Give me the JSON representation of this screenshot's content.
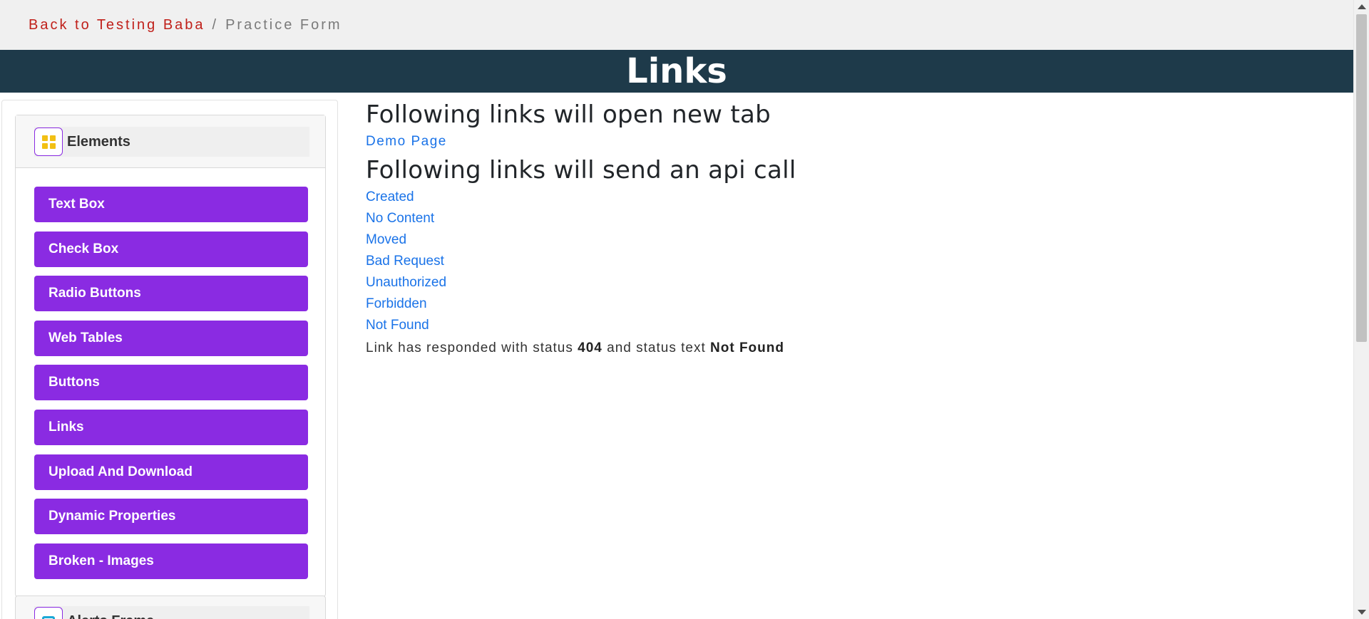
{
  "breadcrumb": {
    "link_label": "Back to Testing Baba",
    "separator": "/",
    "current": "Practice Form"
  },
  "page_title": "Links",
  "sidebar": {
    "group_title": "Elements",
    "items": [
      {
        "label": "Text Box"
      },
      {
        "label": "Check Box"
      },
      {
        "label": "Radio Buttons"
      },
      {
        "label": "Web Tables"
      },
      {
        "label": "Buttons"
      },
      {
        "label": "Links"
      },
      {
        "label": "Upload And Download"
      },
      {
        "label": "Dynamic Properties"
      },
      {
        "label": "Broken - Images"
      }
    ],
    "next_group_title": "Alerts Frame"
  },
  "main": {
    "heading_new_tab": "Following links will open new tab",
    "demo_link": "Demo Page",
    "heading_api": "Following links will send an api call",
    "api_links": [
      {
        "label": "Created"
      },
      {
        "label": "No Content"
      },
      {
        "label": "Moved"
      },
      {
        "label": "Bad Request"
      },
      {
        "label": "Unauthorized"
      },
      {
        "label": "Forbidden"
      },
      {
        "label": "Not Found"
      }
    ],
    "response": {
      "prefix": "Link has responded with status",
      "status_code": "404",
      "middle": "and status text",
      "status_text": "Not Found"
    }
  },
  "colors": {
    "accent_purple": "#8a2be2",
    "header_dark": "#1e3a4a",
    "breadcrumb_red": "#c0201a",
    "link_blue": "#1a73e8"
  }
}
